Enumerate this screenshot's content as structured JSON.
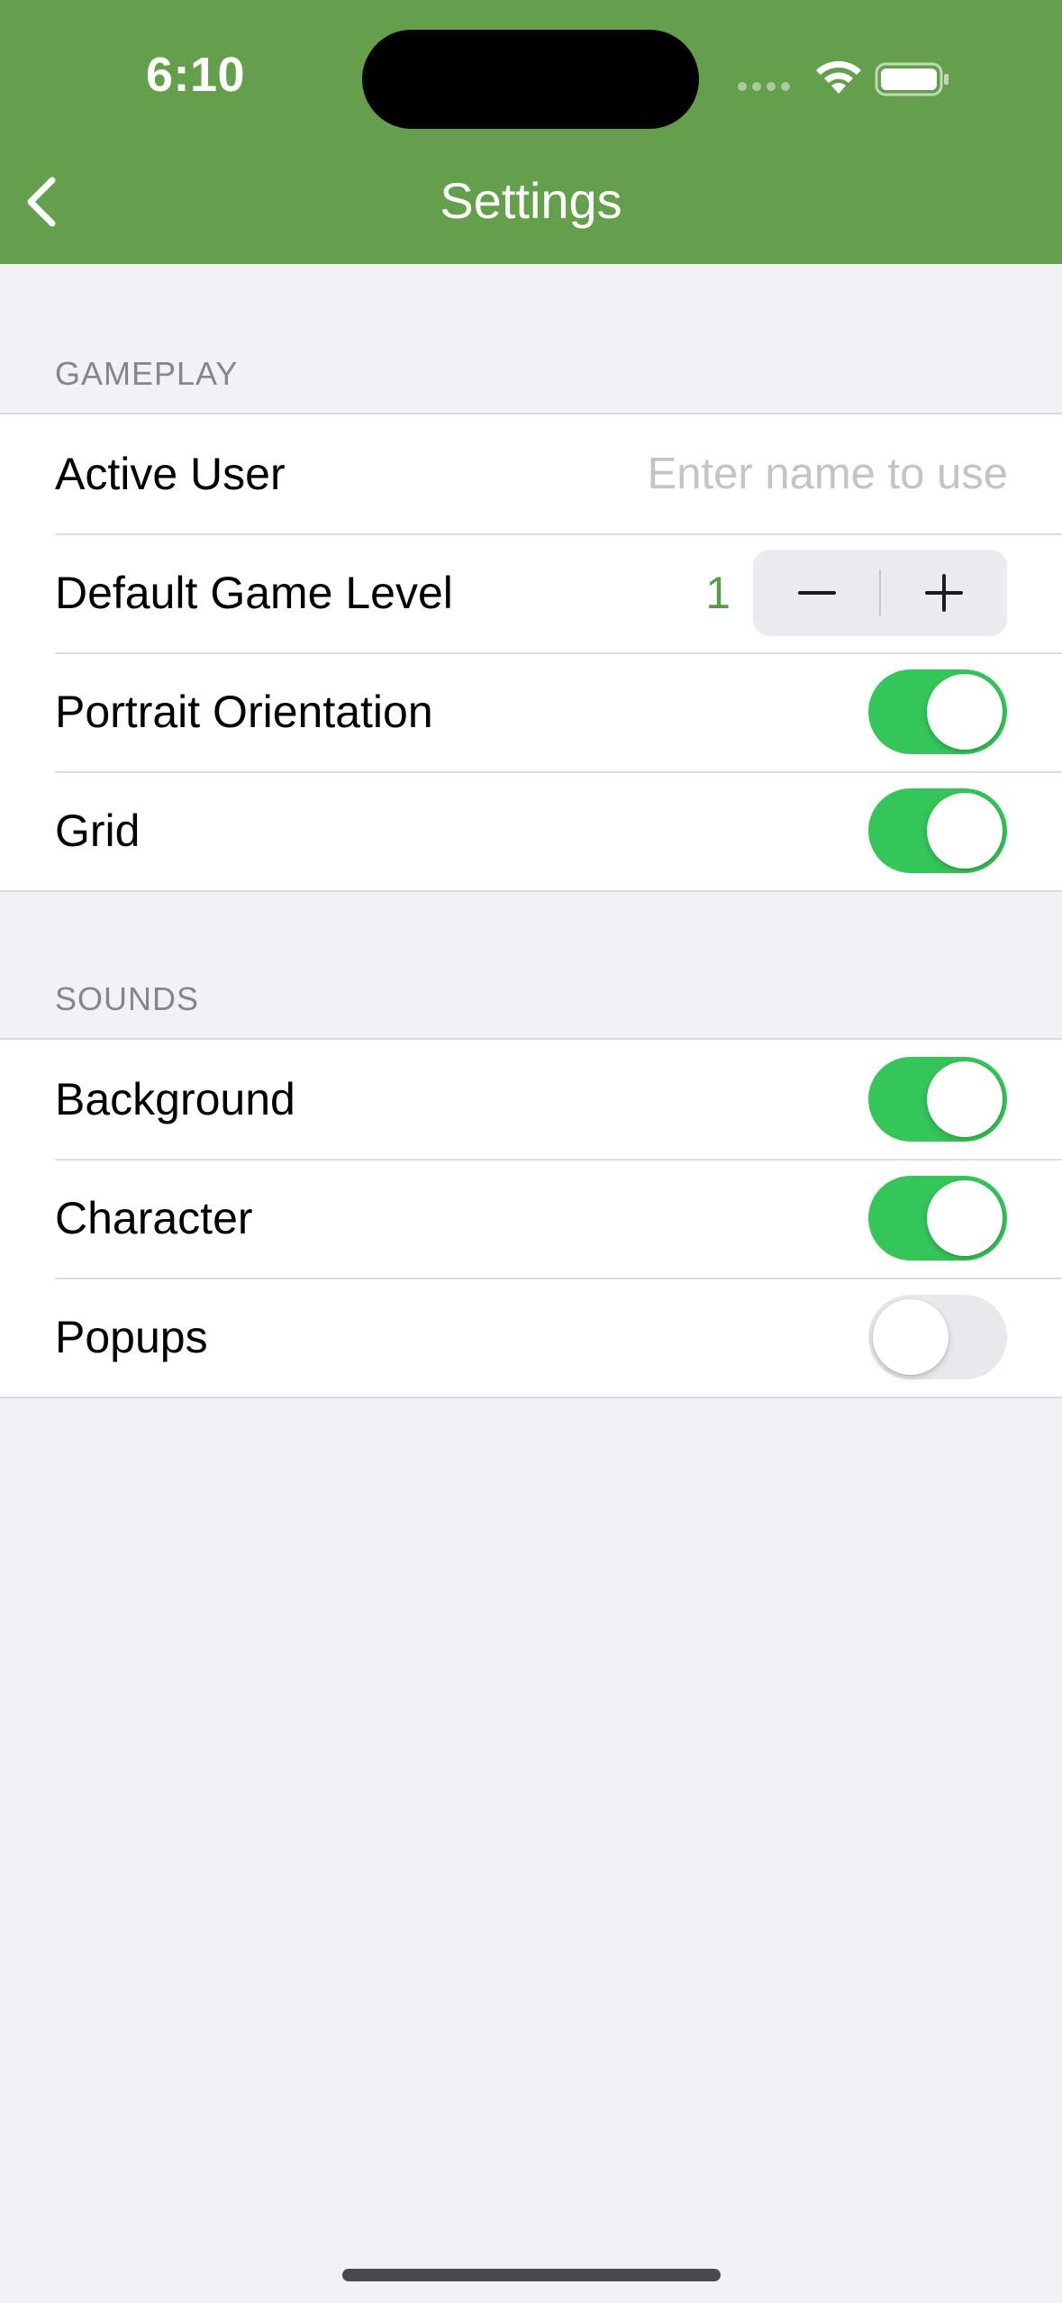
{
  "status_bar": {
    "time": "6:10"
  },
  "nav": {
    "title": "Settings",
    "back_icon": "chevron-left-icon"
  },
  "colors": {
    "header": "#64a04b",
    "toggle_on": "#34c659",
    "accent_value": "#5a9c44"
  },
  "gameplay": {
    "header": "GAMEPLAY",
    "active_user": {
      "label": "Active User",
      "value": "",
      "placeholder": "Enter name to use"
    },
    "default_level": {
      "label": "Default Game Level",
      "value": "1"
    },
    "portrait": {
      "label": "Portrait Orientation",
      "on": true
    },
    "grid": {
      "label": "Grid",
      "on": true
    }
  },
  "sounds": {
    "header": "SOUNDS",
    "background": {
      "label": "Background",
      "on": true
    },
    "character": {
      "label": "Character",
      "on": true
    },
    "popups": {
      "label": "Popups",
      "on": false
    }
  }
}
